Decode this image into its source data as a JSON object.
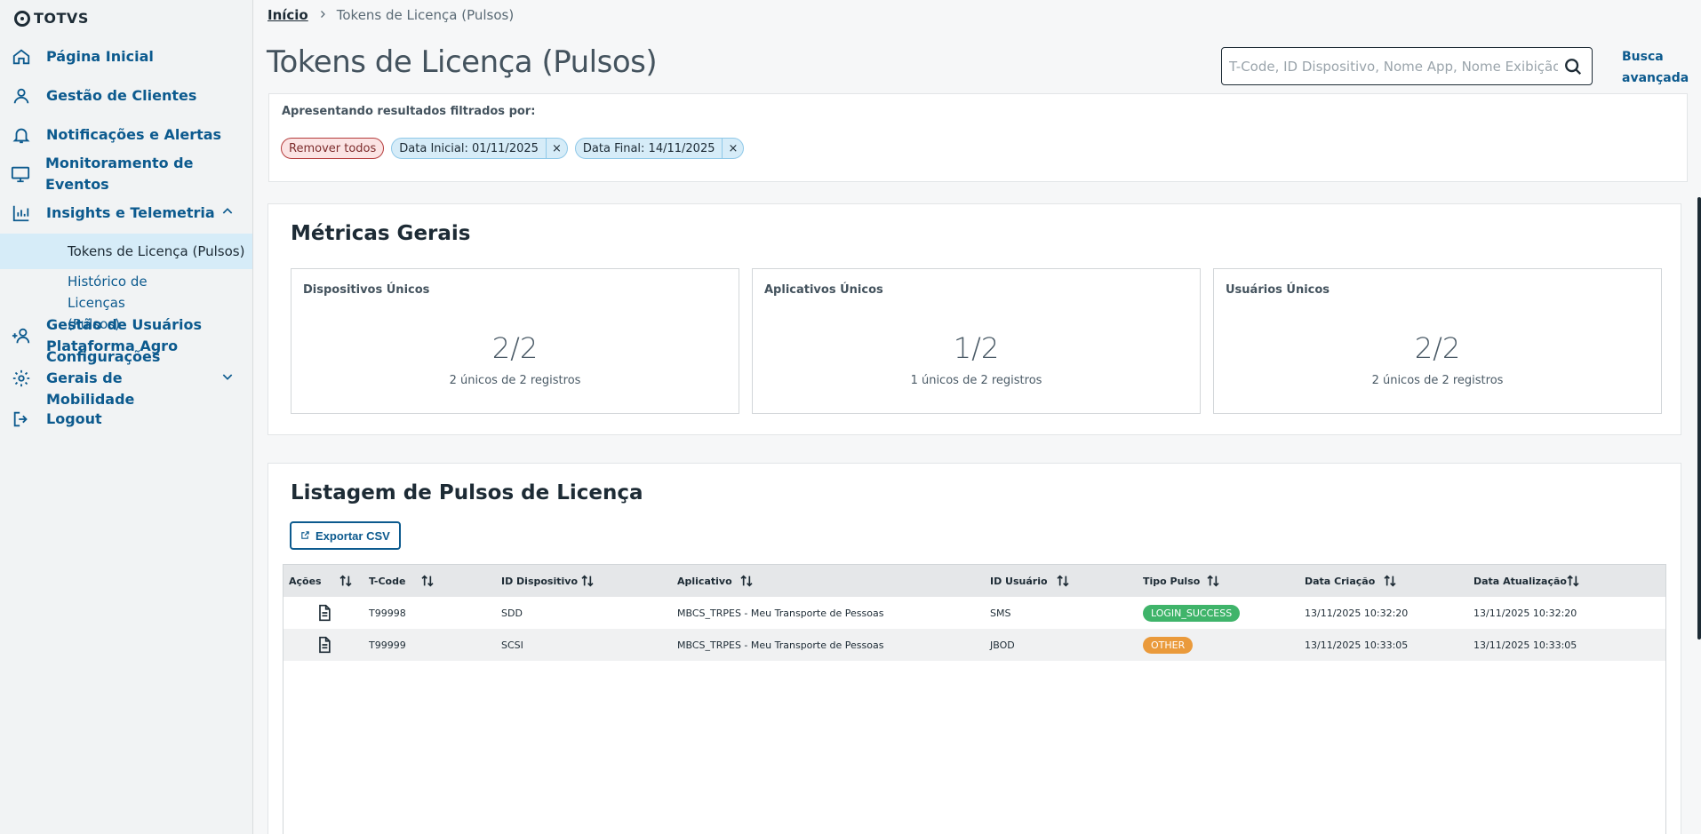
{
  "brand": {
    "name": "TOTVS"
  },
  "sidebar": {
    "items": [
      {
        "label": "Página Inicial",
        "icon": "home-icon"
      },
      {
        "label": "Gestão de Clientes",
        "icon": "user-icon"
      },
      {
        "label": "Notificações e Alertas",
        "icon": "bell-icon"
      },
      {
        "label": "Monitoramento de Eventos",
        "icon": "monitor-icon"
      },
      {
        "label": "Insights e Telemetria",
        "icon": "bar-chart-icon"
      },
      {
        "label": "Gestão de Usuários Plataforma Agro",
        "icon": "add-user-icon"
      },
      {
        "label": "Configurações Gerais de Mobilidade",
        "icon": "gear-icon"
      },
      {
        "label": "Logout",
        "icon": "logout-icon"
      }
    ],
    "sub_items": [
      {
        "label": "Tokens de Licença (Pulsos)",
        "active": true
      },
      {
        "label": "Histórico de Licenças (Pulsos)",
        "active": false
      }
    ]
  },
  "breadcrumb": {
    "home": "Início",
    "current": "Tokens de Licença (Pulsos)"
  },
  "page": {
    "title": "Tokens de Licença (Pulsos)"
  },
  "search": {
    "placeholder": "T-Code, ID Dispositivo, Nome App, Nome Exibição App",
    "advanced_label": "Busca avançada"
  },
  "filters": {
    "title": "Apresentando resultados filtrados por:",
    "remove_all": "Remover todos",
    "chips": [
      "Data Inicial: 01/11/2025",
      "Data Final: 14/11/2025"
    ],
    "remove_symbol": "×"
  },
  "metrics": {
    "title": "Métricas Gerais",
    "cards": [
      {
        "label": "Dispositivos Únicos",
        "value": "2/2",
        "sub": "2 únicos de 2 registros"
      },
      {
        "label": "Aplicativos Únicos",
        "value": "1/2",
        "sub": "1 únicos de 2 registros"
      },
      {
        "label": "Usuários Únicos",
        "value": "2/2",
        "sub": "2 únicos de 2 registros"
      }
    ]
  },
  "listing": {
    "title": "Listagem de Pulsos de Licença",
    "export_label": "Exportar CSV",
    "columns": [
      "Ações",
      "T-Code",
      "ID Dispositivo",
      "Aplicativo",
      "ID Usuário",
      "Tipo Pulso",
      "Data Criação",
      "Data Atualização"
    ],
    "rows": [
      {
        "tcode": "T99998",
        "device": "SDD",
        "app": "MBCS_TRPES - Meu Transporte de Pessoas",
        "user": "SMS",
        "type": "LOGIN_SUCCESS",
        "type_color": "#3fb46a",
        "created": "13/11/2025 10:32:20",
        "updated": "13/11/2025 10:32:20"
      },
      {
        "tcode": "T99999",
        "device": "SCSI",
        "app": "MBCS_TRPES - Meu Transporte de Pessoas",
        "user": "JBOD",
        "type": "OTHER",
        "type_color": "#ea9a3b",
        "created": "13/11/2025 10:33:05",
        "updated": "13/11/2025 10:33:05"
      }
    ]
  },
  "colors": {
    "accent": "#0c5a8e",
    "active_bg": "#d6ecf8",
    "text": "#1d2b35"
  }
}
